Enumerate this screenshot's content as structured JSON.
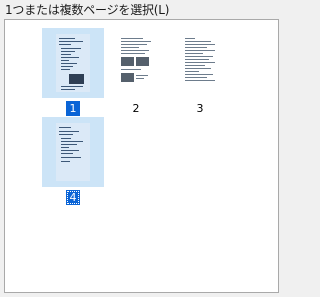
{
  "dialog": {
    "prompt": "1つまたは複数ページを選択(L)"
  },
  "pages": [
    {
      "number": "1",
      "selected": true
    },
    {
      "number": "2",
      "selected": false
    },
    {
      "number": "3",
      "selected": false
    },
    {
      "number": "4",
      "selected": true
    }
  ],
  "colors": {
    "selection_background": "#cce4f7",
    "selected_number_background": "#0a64d6"
  }
}
